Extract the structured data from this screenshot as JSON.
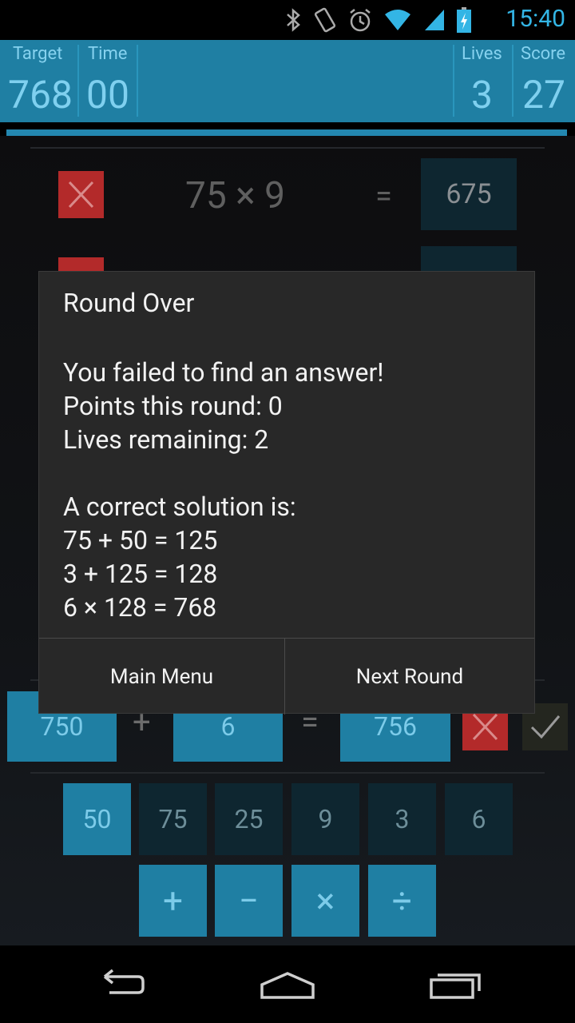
{
  "status_bar": {
    "time": "15:40",
    "icons": [
      "bluetooth-icon",
      "vibrate-icon",
      "alarm-icon",
      "wifi-icon",
      "signal-icon",
      "battery-charging-icon"
    ],
    "accent": "#33b5e5"
  },
  "header": {
    "target_label": "Target",
    "target_value": "768",
    "time_label": "Time",
    "time_value": "00",
    "lives_label": "Lives",
    "lives_value": "3",
    "score_label": "Score",
    "score_value": "27"
  },
  "history": [
    {
      "expression": "75 × 9",
      "equals": "=",
      "result": "675",
      "status": "wrong"
    }
  ],
  "current_equation": {
    "left": "750",
    "operator": "+",
    "right": "6",
    "equals": "=",
    "result": "756"
  },
  "numbers": [
    {
      "value": "50",
      "selected": true
    },
    {
      "value": "75",
      "selected": false
    },
    {
      "value": "25",
      "selected": false
    },
    {
      "value": "9",
      "selected": false
    },
    {
      "value": "3",
      "selected": false
    },
    {
      "value": "6",
      "selected": false
    }
  ],
  "operators": [
    "+",
    "−",
    "×",
    "÷"
  ],
  "dialog": {
    "title": "Round Over",
    "lines": [
      "You failed to find an answer!",
      "Points this round: 0",
      "Lives remaining: 2",
      "",
      "A correct solution is:",
      "75 + 50 = 125",
      "3 + 125 = 128",
      "6 × 128 = 768"
    ],
    "left_button": "Main Menu",
    "right_button": "Next Round"
  },
  "colors": {
    "header_bg": "#1f7fa3",
    "tile_blue": "#1f7fa3",
    "tile_dark": "#0e2630",
    "wrong_red": "#b32a2a",
    "dialog_bg": "#282828"
  }
}
